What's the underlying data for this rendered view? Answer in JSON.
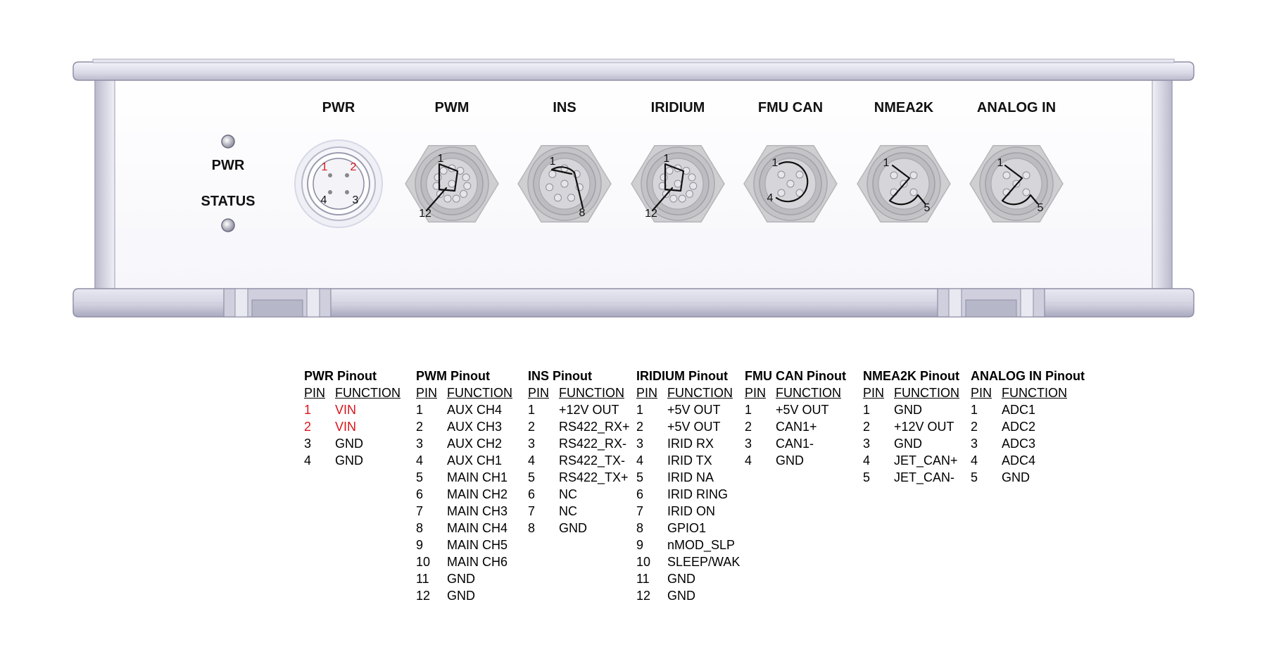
{
  "indicators": [
    {
      "label": "PWR"
    },
    {
      "label": "STATUS"
    }
  ],
  "connectors": [
    {
      "id": "pwr",
      "label": "PWR",
      "pins": [
        {
          "text": "1",
          "red": true
        },
        {
          "text": "2",
          "red": true
        },
        {
          "text": "4",
          "red": false
        },
        {
          "text": "3",
          "red": false
        }
      ]
    },
    {
      "id": "pwm",
      "label": "PWM",
      "pins": [
        {
          "text": "1"
        },
        {
          "text": "12"
        }
      ]
    },
    {
      "id": "ins",
      "label": "INS",
      "pins": [
        {
          "text": "1"
        },
        {
          "text": "8"
        }
      ]
    },
    {
      "id": "iridium",
      "label": "IRIDIUM",
      "pins": [
        {
          "text": "1"
        },
        {
          "text": "12"
        }
      ]
    },
    {
      "id": "fmucan",
      "label": "FMU CAN",
      "pins": [
        {
          "text": "1"
        },
        {
          "text": "4"
        }
      ]
    },
    {
      "id": "nmea2k",
      "label": "NMEA2K",
      "pins": [
        {
          "text": "1"
        },
        {
          "text": "5"
        }
      ]
    },
    {
      "id": "analog",
      "label": "ANALOG IN",
      "pins": [
        {
          "text": "1"
        },
        {
          "text": "5"
        }
      ]
    }
  ],
  "pinouts": [
    {
      "title": "PWR Pinout",
      "col_pin": "PIN",
      "col_function": "FUNCTION",
      "rows": [
        {
          "pin": "1",
          "function": "VIN",
          "highlight": true
        },
        {
          "pin": "2",
          "function": "VIN",
          "highlight": true
        },
        {
          "pin": "3",
          "function": "GND",
          "highlight": false
        },
        {
          "pin": "4",
          "function": "GND",
          "highlight": false
        }
      ]
    },
    {
      "title": "PWM Pinout",
      "col_pin": "PIN",
      "col_function": "FUNCTION",
      "rows": [
        {
          "pin": "1",
          "function": "AUX CH4"
        },
        {
          "pin": "2",
          "function": "AUX CH3"
        },
        {
          "pin": "3",
          "function": "AUX CH2"
        },
        {
          "pin": "4",
          "function": "AUX CH1"
        },
        {
          "pin": "5",
          "function": "MAIN CH1"
        },
        {
          "pin": "6",
          "function": "MAIN CH2"
        },
        {
          "pin": "7",
          "function": "MAIN CH3"
        },
        {
          "pin": "8",
          "function": "MAIN CH4"
        },
        {
          "pin": "9",
          "function": "MAIN CH5"
        },
        {
          "pin": "10",
          "function": "MAIN CH6"
        },
        {
          "pin": "11",
          "function": "GND"
        },
        {
          "pin": "12",
          "function": "GND"
        }
      ]
    },
    {
      "title": "INS Pinout",
      "col_pin": "PIN",
      "col_function": "FUNCTION",
      "rows": [
        {
          "pin": "1",
          "function": "+12V OUT"
        },
        {
          "pin": "2",
          "function": "RS422_RX+"
        },
        {
          "pin": "3",
          "function": "RS422_RX-"
        },
        {
          "pin": "4",
          "function": "RS422_TX-"
        },
        {
          "pin": "5",
          "function": "RS422_TX+"
        },
        {
          "pin": "6",
          "function": "NC"
        },
        {
          "pin": "7",
          "function": "NC"
        },
        {
          "pin": "8",
          "function": "GND"
        }
      ]
    },
    {
      "title": "IRIDIUM Pinout",
      "col_pin": "PIN",
      "col_function": "FUNCTION",
      "rows": [
        {
          "pin": "1",
          "function": "+5V OUT"
        },
        {
          "pin": "2",
          "function": "+5V OUT"
        },
        {
          "pin": "3",
          "function": "IRID RX"
        },
        {
          "pin": "4",
          "function": "IRID TX"
        },
        {
          "pin": "5",
          "function": "IRID NA"
        },
        {
          "pin": "6",
          "function": "IRID RING"
        },
        {
          "pin": "7",
          "function": "IRID ON"
        },
        {
          "pin": "8",
          "function": "GPIO1"
        },
        {
          "pin": "9",
          "function": "nMOD_SLP"
        },
        {
          "pin": "10",
          "function": "SLEEP/WAK"
        },
        {
          "pin": "11",
          "function": "GND"
        },
        {
          "pin": "12",
          "function": "GND"
        }
      ]
    },
    {
      "title": "FMU CAN Pinout",
      "col_pin": "PIN",
      "col_function": "FUNCTION",
      "rows": [
        {
          "pin": "1",
          "function": "+5V OUT"
        },
        {
          "pin": "2",
          "function": "CAN1+"
        },
        {
          "pin": "3",
          "function": "CAN1-"
        },
        {
          "pin": "4",
          "function": "GND"
        }
      ]
    },
    {
      "title": "NMEA2K Pinout",
      "col_pin": "PIN",
      "col_function": "FUNCTION",
      "rows": [
        {
          "pin": "1",
          "function": "GND"
        },
        {
          "pin": "2",
          "function": "+12V OUT"
        },
        {
          "pin": "3",
          "function": "GND"
        },
        {
          "pin": "4",
          "function": "JET_CAN+"
        },
        {
          "pin": "5",
          "function": "JET_CAN-"
        }
      ]
    },
    {
      "title": "ANALOG IN Pinout",
      "col_pin": "PIN",
      "col_function": "FUNCTION",
      "rows": [
        {
          "pin": "1",
          "function": "ADC1"
        },
        {
          "pin": "2",
          "function": "ADC2"
        },
        {
          "pin": "3",
          "function": "ADC3"
        },
        {
          "pin": "4",
          "function": "ADC4"
        },
        {
          "pin": "5",
          "function": "GND"
        }
      ]
    }
  ]
}
